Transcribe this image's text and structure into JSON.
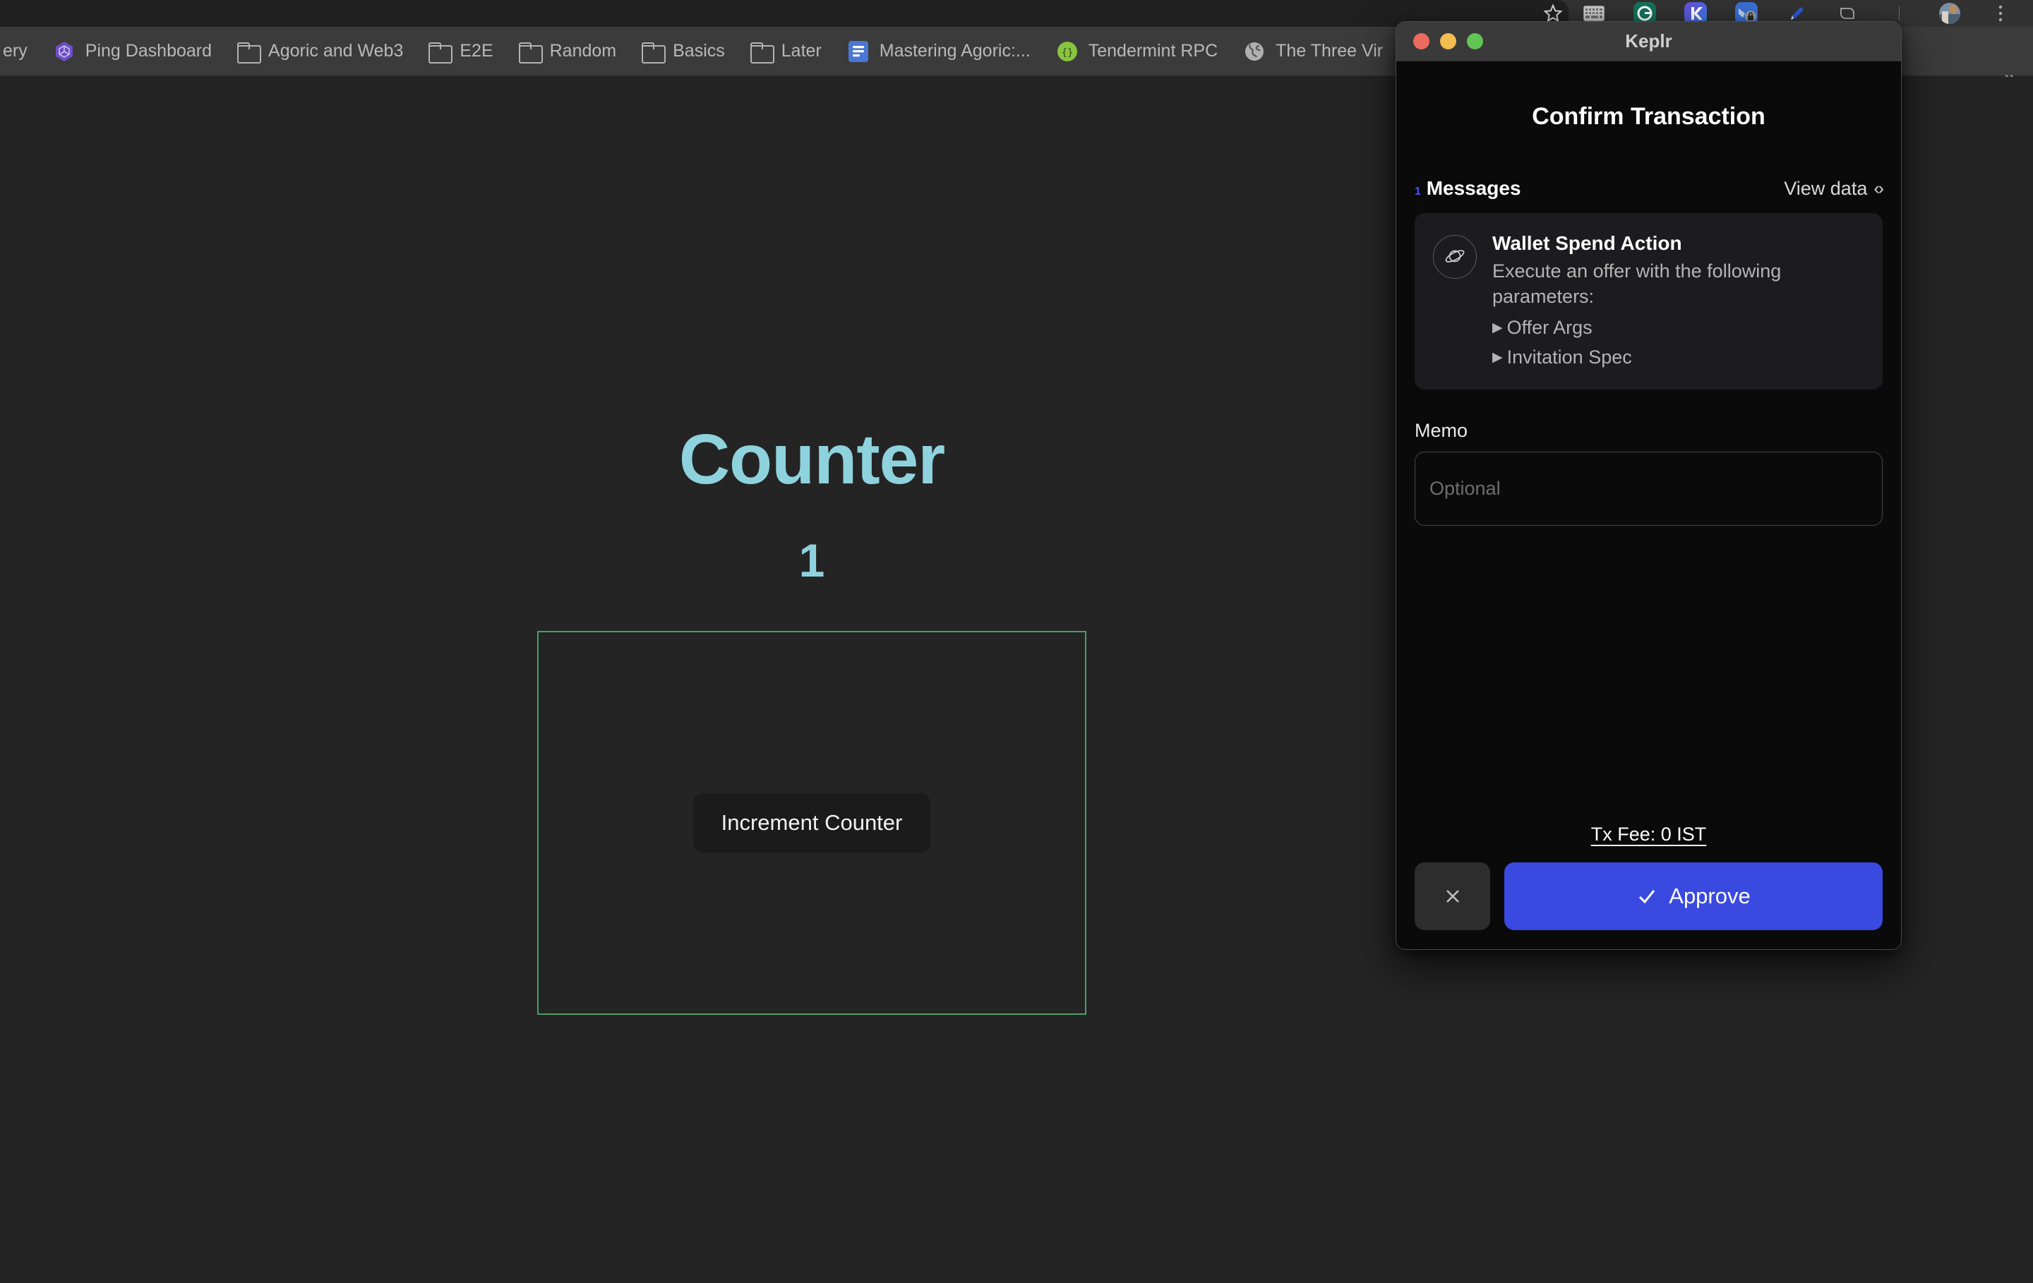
{
  "browser": {
    "bookmarks": [
      {
        "label": "ery",
        "icon": "partial-bookmark-text",
        "icon_kind": "none"
      },
      {
        "label": "Ping Dashboard",
        "icon": "ping-dashboard-favicon",
        "icon_kind": "hex-purple"
      },
      {
        "label": "Agoric and Web3",
        "icon": "folder-icon",
        "icon_kind": "folder"
      },
      {
        "label": "E2E",
        "icon": "folder-icon",
        "icon_kind": "folder"
      },
      {
        "label": "Random",
        "icon": "folder-icon",
        "icon_kind": "folder"
      },
      {
        "label": "Basics",
        "icon": "folder-icon",
        "icon_kind": "folder"
      },
      {
        "label": "Later",
        "icon": "folder-icon",
        "icon_kind": "folder"
      },
      {
        "label": "Mastering Agoric:...",
        "icon": "google-docs-favicon",
        "icon_kind": "docs"
      },
      {
        "label": "Tendermint RPC",
        "icon": "tendermint-favicon",
        "icon_kind": "green-circle"
      },
      {
        "label": "The Three Vir",
        "icon": "globe-favicon",
        "icon_kind": "globe"
      }
    ],
    "overflow_label": "»",
    "toolbar_icons": [
      "bookmark-star-icon",
      "keyboard-extension-icon",
      "grammarly-extension-icon",
      "keplr-extension-icon",
      "metamask-lock-extension-icon",
      "pen-extension-icon",
      "share-icon",
      "profile-avatar",
      "chrome-menu-icon"
    ]
  },
  "page": {
    "title": "Counter",
    "value": "1",
    "increment_button": "Increment Counter",
    "accent_color": "#8ed2dd",
    "box_border_color": "#4a9e6a",
    "background_color": "#242424"
  },
  "keplr": {
    "window_title": "Keplr",
    "heading": "Confirm Transaction",
    "messages": {
      "count": "1",
      "count_suffix": "Messages",
      "view_data_label": "View data",
      "view_data_glyph": "‹›"
    },
    "message_card": {
      "icon": "planet-icon",
      "title": "Wallet Spend Action",
      "description": "Execute an offer with the following parameters:",
      "disclosures": [
        {
          "label": "Offer Args",
          "expanded": false
        },
        {
          "label": "Invitation Spec",
          "expanded": false
        }
      ]
    },
    "memo": {
      "label": "Memo",
      "value": "",
      "placeholder": "Optional"
    },
    "tx_fee": "Tx Fee: 0 IST",
    "buttons": {
      "cancel": "✕",
      "approve": "Approve",
      "approve_color": "#3a4ae0"
    }
  }
}
